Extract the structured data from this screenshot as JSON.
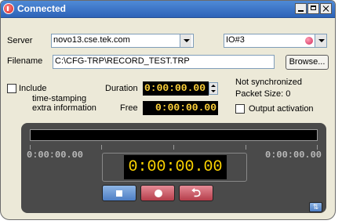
{
  "window": {
    "title": "Connected"
  },
  "server": {
    "label": "Server",
    "value": "novo13.cse.tek.com",
    "device_value": "IO#3"
  },
  "filename": {
    "label": "Filename",
    "value": "C:\\CFG-TRP\\RECORD_TEST.TRP",
    "browse_label": "Browse..."
  },
  "include": {
    "line1": "Include",
    "line2": "time-stamping",
    "line3": "extra information",
    "checked": false
  },
  "duration": {
    "label": "Duration",
    "value": "0:00:00.00"
  },
  "free": {
    "label": "Free",
    "value": "0:00:00.00"
  },
  "status": {
    "sync": "Not synchronized",
    "packet_size": "Packet Size: 0",
    "output_activation_label": "Output activation",
    "output_activation_checked": false
  },
  "player": {
    "progress_fraction": 0,
    "left_time": "0:00:00.00",
    "right_time": "0:00:00.00",
    "current_time": "0:00:00.00",
    "loop_glyph": "⮌",
    "corner_glyph": "⇅"
  },
  "colors": {
    "time_text": "#ffd500",
    "panel": "#4a4a4a",
    "stop_button": "#5d8ed0",
    "record_button": "#c95060"
  }
}
